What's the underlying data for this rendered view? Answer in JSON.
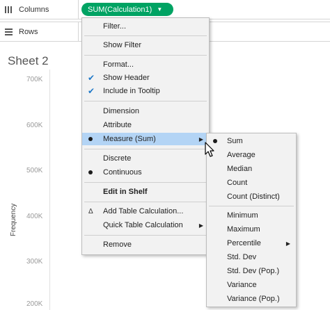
{
  "shelves": {
    "columns_label": "Columns",
    "rows_label": "Rows",
    "pill_label": "SUM(Calculation1)",
    "pill_color": "#00a363"
  },
  "sheet": {
    "title": "Sheet 2",
    "y_axis_label": "Frequency",
    "y_ticks": [
      "700K",
      "600K",
      "500K",
      "400K",
      "300K",
      "200K"
    ]
  },
  "main_menu": {
    "filter": "Filter...",
    "show_filter": "Show Filter",
    "format": "Format...",
    "show_header": "Show Header",
    "include_in_tooltip": "Include in Tooltip",
    "dimension": "Dimension",
    "attribute": "Attribute",
    "measure": "Measure (Sum)",
    "discrete": "Discrete",
    "continuous": "Continuous",
    "edit_in_shelf": "Edit in Shelf",
    "add_table_calc": "Add Table Calculation...",
    "quick_table_calc": "Quick Table Calculation",
    "remove": "Remove"
  },
  "sub_menu": {
    "sum": "Sum",
    "average": "Average",
    "median": "Median",
    "count": "Count",
    "count_distinct": "Count (Distinct)",
    "minimum": "Minimum",
    "maximum": "Maximum",
    "percentile": "Percentile",
    "std_dev": "Std. Dev",
    "std_dev_pop": "Std. Dev (Pop.)",
    "variance": "Variance",
    "variance_pop": "Variance (Pop.)"
  },
  "colors": {
    "highlight": "#b3d4f5",
    "check": "#1e78c8"
  }
}
